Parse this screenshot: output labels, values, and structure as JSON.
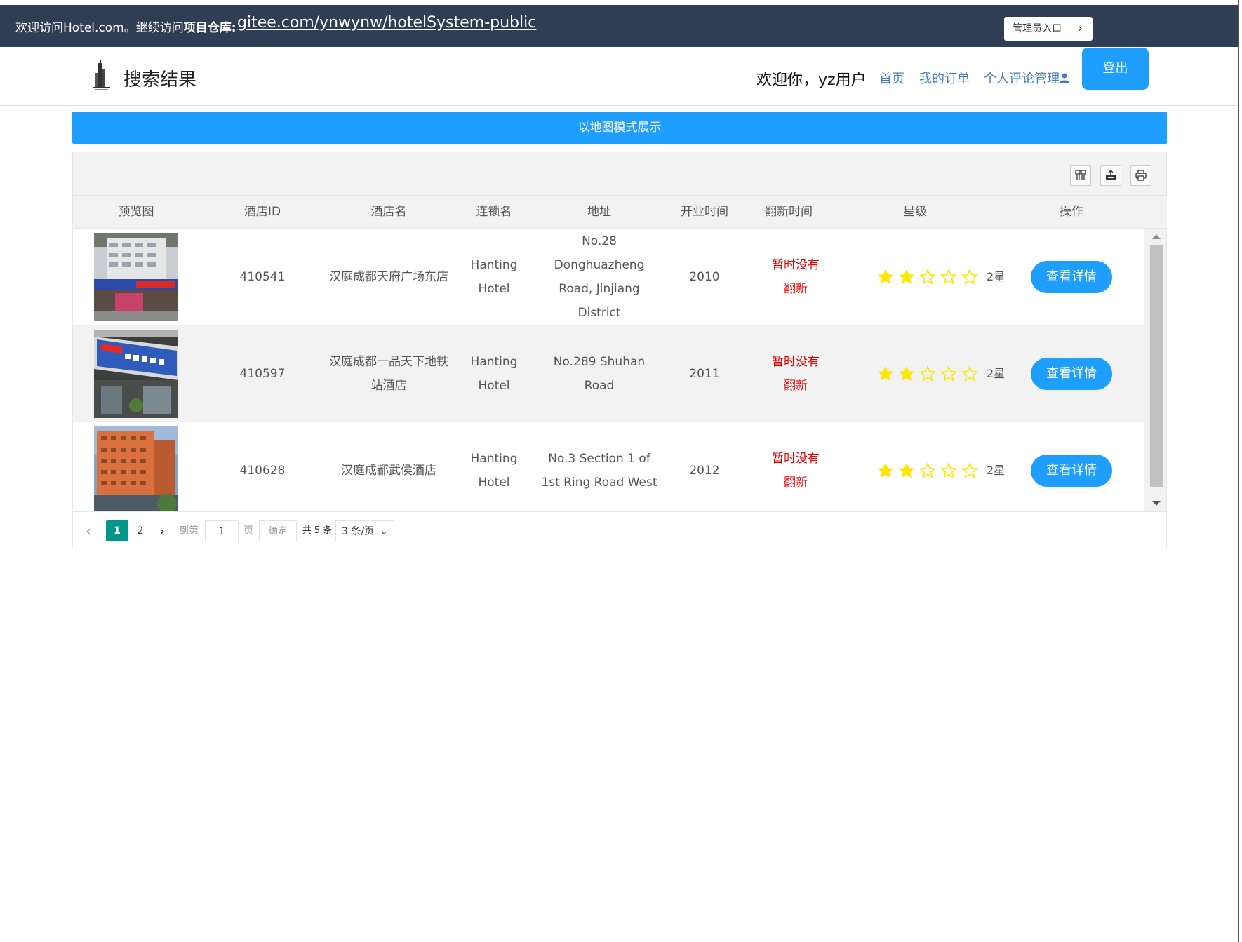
{
  "notice": {
    "prefix": "欢迎访问Hotel.com。继续访问",
    "repo_label": "项目仓库:",
    "repo_link": "gitee.com/ynwynw/hotelSystem-public",
    "admin_label": "管理员入口"
  },
  "header": {
    "title": "搜索结果",
    "welcome": "欢迎你，yz用户",
    "nav": [
      "首页",
      "我的订单",
      "个人评论管理"
    ],
    "logout": "登出"
  },
  "map_mode_label": "以地图模式展示",
  "table": {
    "toolbar_icons": [
      "columns-icon",
      "export-icon",
      "print-icon"
    ],
    "columns": [
      "预览图",
      "酒店ID",
      "酒店名",
      "连锁名",
      "地址",
      "开业时间",
      "翻新时间",
      "星级",
      "操作"
    ],
    "rows": [
      {
        "id": "410541",
        "name": "汉庭成都天府广场东店",
        "chain": "Hanting Hotel",
        "address": "No.28 Donghuazheng Road, Jinjiang District",
        "opened": "2010",
        "renovated": "暂时没有翻新",
        "stars": 2,
        "star_label": "2星",
        "action": "查看详情"
      },
      {
        "id": "410597",
        "name": "汉庭成都一品天下地铁站酒店",
        "chain": "Hanting Hotel",
        "address": "No.289 Shuhan Road",
        "opened": "2011",
        "renovated": "暂时没有翻新",
        "stars": 2,
        "star_label": "2星",
        "action": "查看详情"
      },
      {
        "id": "410628",
        "name": "汉庭成都武侯酒店",
        "chain": "Hanting Hotel",
        "address": "No.3 Section 1 of 1st Ring Road West",
        "opened": "2012",
        "renovated": "暂时没有翻新",
        "stars": 2,
        "star_label": "2星",
        "action": "查看详情"
      }
    ]
  },
  "pager": {
    "current": "1",
    "next_page": "2",
    "goto_label": "到第",
    "goto_value": "1",
    "page_unit": "页",
    "confirm": "确定",
    "total": "共 5 条",
    "page_size": "3 条/页"
  },
  "colors": {
    "notice_bg": "#2f3e55",
    "primary": "#1e9fff",
    "pager_current": "#009688",
    "renovation_text": "#e60000",
    "star_filled": "#ffe600"
  }
}
